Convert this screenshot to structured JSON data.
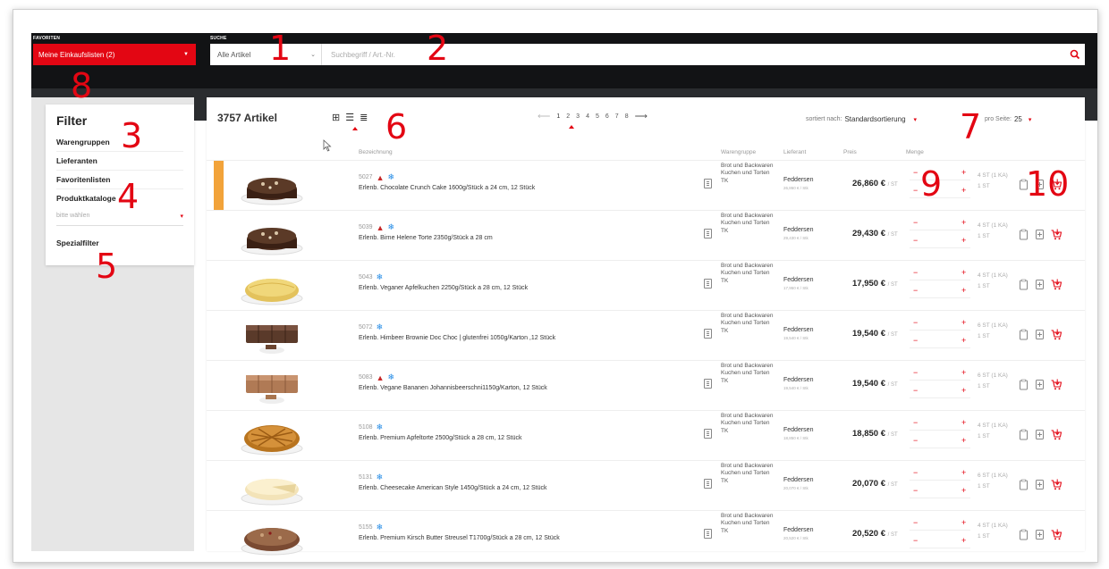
{
  "header": {
    "favorites_label": "FAVORITEN",
    "favorites_value": "Meine Einkaufslisten (2)",
    "search_label": "SUCHE",
    "search_category": "Alle Artikel",
    "search_placeholder": "Suchbegriff / Art.-Nr."
  },
  "sidebar": {
    "title": "Filter",
    "items": [
      "Warengruppen",
      "Lieferanten",
      "Favoritenlisten",
      "Produktkataloge"
    ],
    "select_placeholder": "bitte wählen",
    "special": "Spezialfilter"
  },
  "toolbar": {
    "count": "3757 Artikel",
    "pages": [
      "1",
      "2",
      "3",
      "4",
      "5",
      "6",
      "7",
      "8"
    ],
    "active_page": "1",
    "sort_label": "sortiert nach:",
    "sort_value": "Standardsortierung",
    "perpage_label": "pro Seite:",
    "perpage_value": "25"
  },
  "columns": {
    "name": "Bezeichnung",
    "group": "Warengruppe",
    "supplier": "Lieferant",
    "price": "Preis",
    "qty": "Menge"
  },
  "products": [
    {
      "num": "5027",
      "warn": true,
      "name": "Erlenb. Chocolate Crunch Cake 1600g/Stück a 24 cm, 12 Stück",
      "group": "Brot und Backwaren Kuchen und Torten TK",
      "supplier": "Feddersen",
      "unit_price": "26,860 € / Stk",
      "price": "26,860 €",
      "unit": "/ ST",
      "u1": "4 ST (1 KA)",
      "u2": "1 ST",
      "highlight": true,
      "img": "choc"
    },
    {
      "num": "5039",
      "warn": true,
      "name": "Erlenb. Birne Helene Torte 2350g/Stück a 28 cm",
      "group": "Brot und Backwaren Kuchen und Torten TK",
      "supplier": "Feddersen",
      "unit_price": "29,430 € / Stk",
      "price": "29,430 €",
      "unit": "/ ST",
      "u1": "4 ST (1 KA)",
      "u2": "1 ST",
      "highlight": false,
      "img": "choc"
    },
    {
      "num": "5043",
      "warn": false,
      "name": "Erlenb. Veganer Apfelkuchen 2250g/Stück a 28 cm, 12 Stück",
      "group": "Brot und Backwaren Kuchen und Torten TK",
      "supplier": "Feddersen",
      "unit_price": "17,950 € / Stk",
      "price": "17,950 €",
      "unit": "/ ST",
      "u1": "4 ST (1 KA)",
      "u2": "1 ST",
      "highlight": false,
      "img": "apple"
    },
    {
      "num": "5072",
      "warn": false,
      "name": "Erlenb. Himbeer Brownie Doc Choc | glutenfrei 1050g/Karton ,12 Stück",
      "group": "Brot und Backwaren Kuchen und Torten TK",
      "supplier": "Feddersen",
      "unit_price": "19,540 € / Stk",
      "price": "19,540 €",
      "unit": "/ ST",
      "u1": "6 ST (1 KA)",
      "u2": "1 ST",
      "highlight": false,
      "img": "sheet"
    },
    {
      "num": "5083",
      "warn": true,
      "name": "Erlenb. Vegane Bananen Johannisbeerschni1150g/Karton, 12 Stück",
      "group": "Brot und Backwaren Kuchen und Torten TK",
      "supplier": "Feddersen",
      "unit_price": "19,540 € / Stk",
      "price": "19,540 €",
      "unit": "/ ST",
      "u1": "6 ST (1 KA)",
      "u2": "1 ST",
      "highlight": false,
      "img": "sheetlight"
    },
    {
      "num": "5108",
      "warn": false,
      "name": "Erlenb. Premium Apfeltorte 2500g/Stück a 28 cm, 12 Stück",
      "group": "Brot und Backwaren Kuchen und Torten TK",
      "supplier": "Feddersen",
      "unit_price": "18,850 € / Stk",
      "price": "18,850 €",
      "unit": "/ ST",
      "u1": "4 ST (1 KA)",
      "u2": "1 ST",
      "highlight": false,
      "img": "lattice"
    },
    {
      "num": "5131",
      "warn": false,
      "name": "Erlenb. Cheesecake American Style 1450g/Stück a 24 cm, 12 Stück",
      "group": "Brot und Backwaren Kuchen und Torten TK",
      "supplier": "Feddersen",
      "unit_price": "20,070 € / Stk",
      "price": "20,070 €",
      "unit": "/ ST",
      "u1": "6 ST (1 KA)",
      "u2": "1 ST",
      "highlight": false,
      "img": "cheese"
    },
    {
      "num": "5155",
      "warn": false,
      "name": "Erlenb. Premium Kirsch Butter Streusel T1700g/Stück a 28 cm, 12 Stück",
      "group": "Brot und Backwaren Kuchen und Torten TK",
      "supplier": "Feddersen",
      "unit_price": "20,520 € / Stk",
      "price": "20,520 €",
      "unit": "/ ST",
      "u1": "4 ST (1 KA)",
      "u2": "1 ST",
      "highlight": false,
      "img": "crumble"
    }
  ],
  "annotations": [
    "1",
    "2",
    "3",
    "4",
    "5",
    "6",
    "7",
    "8",
    "9",
    "10"
  ],
  "colors": {
    "brand_red": "#e30613",
    "topbar": "#121315",
    "highlight": "#f2a33a"
  }
}
